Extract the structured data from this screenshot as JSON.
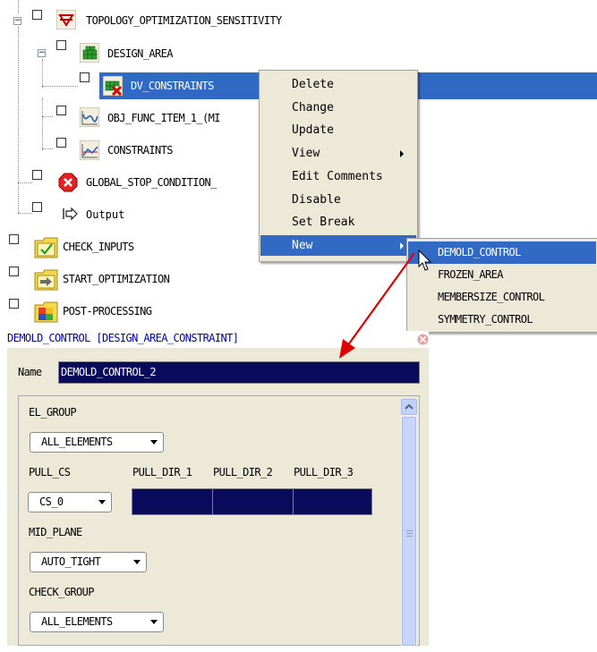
{
  "tree": {
    "items": [
      {
        "label": "TOPOLOGY_OPTIMIZATION_SENSITIVITY",
        "icon": "topology-icon"
      },
      {
        "label": "DESIGN_AREA",
        "icon": "green-grid-icon"
      },
      {
        "label": "DV_CONSTRAINTS",
        "icon": "constraint-grid-icon"
      },
      {
        "label": "OBJ_FUNC_ITEM_1_(MI",
        "icon": "curve-icon"
      },
      {
        "label": "CONSTRAINTS",
        "icon": "graph-icon"
      },
      {
        "label": "GLOBAL_STOP_CONDITION_",
        "icon": "stop-icon"
      },
      {
        "label": "Output",
        "icon": "output-arrow-icon"
      },
      {
        "label": "CHECK_INPUTS",
        "icon": "check-folder-icon"
      },
      {
        "label": "START_OPTIMIZATION",
        "icon": "arrow-folder-icon"
      },
      {
        "label": "POST-PROCESSING",
        "icon": "colormap-folder-icon"
      }
    ]
  },
  "context_menu": {
    "items": [
      {
        "label": "Delete"
      },
      {
        "label": "Change"
      },
      {
        "label": "Update"
      },
      {
        "label": "View"
      },
      {
        "label": "Edit Comments"
      },
      {
        "label": "Disable"
      },
      {
        "label": "Set Break"
      },
      {
        "label": "New"
      }
    ]
  },
  "submenu": {
    "items": [
      {
        "label": "DEMOLD_CONTROL"
      },
      {
        "label": "FROZEN_AREA"
      },
      {
        "label": "MEMBERSIZE_CONTROL"
      },
      {
        "label": "SYMMETRY_CONTROL"
      }
    ]
  },
  "dialog": {
    "title": "DEMOLD_CONTROL [DESIGN_AREA_CONSTRAINT]",
    "name_label": "Name",
    "name_value": "DEMOLD_CONTROL_2",
    "el_group_label": "EL_GROUP",
    "el_group_value": "ALL_ELEMENTS",
    "pull_cs_label": "PULL_CS",
    "pull_cs_value": "CS_0",
    "pull_dir_headers": [
      "PULL_DIR_1",
      "PULL_DIR_2",
      "PULL_DIR_3"
    ],
    "mid_plane_label": "MID_PLANE",
    "mid_plane_value": "AUTO_TIGHT",
    "check_group_label": "CHECK_GROUP",
    "check_group_value": "ALL_ELEMENTS"
  },
  "colors": {
    "selection": "#316ac5",
    "menu_bg": "#ece9d8",
    "name_field_bg": "#0a0a5c",
    "annotation_arrow": "#e00000"
  }
}
